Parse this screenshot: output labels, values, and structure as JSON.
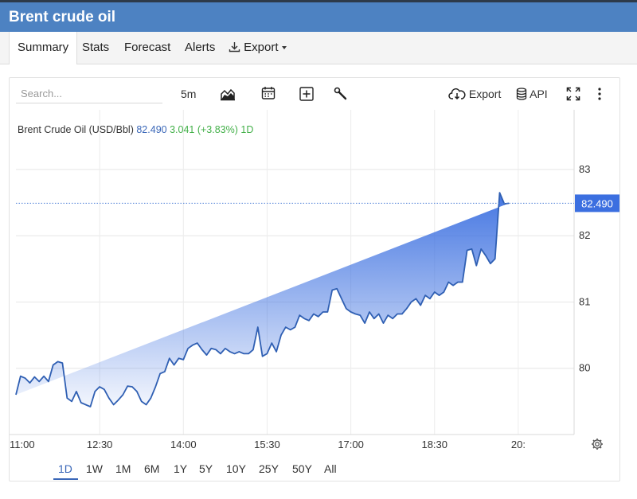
{
  "window": {
    "title": "Brent crude oil"
  },
  "tabs": [
    {
      "label": "Summary",
      "active": true
    },
    {
      "label": "Stats"
    },
    {
      "label": "Forecast"
    },
    {
      "label": "Alerts"
    },
    {
      "label": "Export"
    }
  ],
  "toolbar": {
    "search_placeholder": "Search...",
    "interval": "5m",
    "export_label": "Export",
    "api_label": "API"
  },
  "legend": {
    "name": "Brent Crude Oil (USD/Bbl)",
    "last": "82.490",
    "change": "3.041 (+3.83%)",
    "period": "1D"
  },
  "colors": {
    "header": "#4d82c2",
    "line": "#2f5fb3",
    "fill_top": "#3b6fe0",
    "price_badge": "#3b6fe0",
    "positive": "#43b049"
  },
  "ranges": [
    {
      "label": "1D",
      "active": true
    },
    {
      "label": "1W"
    },
    {
      "label": "1M"
    },
    {
      "label": "6M"
    },
    {
      "label": "1Y"
    },
    {
      "label": "5Y"
    },
    {
      "label": "10Y"
    },
    {
      "label": "25Y"
    },
    {
      "label": "50Y"
    },
    {
      "label": "All"
    }
  ],
  "chart_data": {
    "type": "area",
    "title": "",
    "xlabel": "",
    "ylabel": "",
    "x_ticks": [
      "11:00",
      "12:30",
      "14:00",
      "15:30",
      "17:00",
      "18:30",
      "20:"
    ],
    "y_ticks": [
      "80",
      "81",
      "82",
      "83"
    ],
    "ylim": [
      79.0,
      83.9
    ],
    "grid": true,
    "last_price": 82.49,
    "last_price_label": "82.490",
    "series": [
      {
        "x_minutes": [
          0,
          5,
          10,
          15,
          20,
          25,
          30,
          35,
          40,
          45,
          50,
          55,
          60,
          65,
          70,
          75,
          80,
          85,
          90,
          95,
          100,
          105,
          110,
          115,
          120,
          125,
          130,
          135,
          140,
          145,
          150,
          155,
          160,
          165,
          170,
          175,
          180,
          185,
          190,
          195,
          200,
          205,
          210,
          215,
          220,
          225,
          230,
          235,
          240,
          245,
          250,
          255,
          260,
          265,
          270,
          275,
          280,
          285,
          290,
          295,
          300,
          305,
          310,
          315,
          320,
          325,
          330,
          335,
          340,
          345,
          350,
          355,
          360,
          365,
          370,
          375,
          380,
          385,
          390,
          395,
          400,
          405,
          410,
          415,
          420,
          425,
          430,
          435,
          440,
          445,
          450,
          455,
          460,
          465,
          470,
          475,
          480,
          485,
          490,
          495,
          500,
          505,
          510,
          515,
          520,
          525,
          530,
          535,
          540,
          545,
          550,
          555,
          560,
          565,
          570,
          575,
          580,
          585,
          590
        ],
        "values": [
          79.6,
          79.88,
          79.85,
          79.78,
          79.87,
          79.8,
          79.88,
          79.8,
          80.05,
          80.1,
          80.08,
          79.55,
          79.5,
          79.65,
          79.48,
          79.45,
          79.42,
          79.65,
          79.72,
          79.68,
          79.55,
          79.45,
          79.52,
          79.6,
          79.73,
          79.72,
          79.65,
          79.5,
          79.45,
          79.55,
          79.72,
          79.92,
          79.95,
          80.15,
          80.05,
          80.15,
          80.13,
          80.3,
          80.35,
          80.38,
          80.28,
          80.2,
          80.3,
          80.28,
          80.22,
          80.3,
          80.25,
          80.22,
          80.25,
          80.22,
          80.22,
          80.28,
          80.62,
          80.18,
          80.22,
          80.38,
          80.25,
          80.5,
          80.62,
          80.58,
          80.62,
          80.8,
          80.75,
          80.72,
          80.82,
          80.78,
          80.85,
          80.85,
          81.18,
          81.2,
          81.05,
          80.9,
          80.85,
          80.82,
          80.8,
          80.68,
          80.85,
          80.75,
          80.82,
          80.68,
          80.8,
          80.75,
          80.82,
          80.82,
          80.9,
          81.0,
          81.05,
          80.95,
          81.1,
          81.05,
          81.15,
          81.1,
          81.15,
          81.3,
          81.25,
          81.3,
          81.3,
          81.78,
          81.8,
          81.55,
          81.8,
          81.7,
          81.58,
          81.65,
          82.65,
          82.48,
          82.49
        ],
        "x_start": "11:00"
      }
    ]
  }
}
